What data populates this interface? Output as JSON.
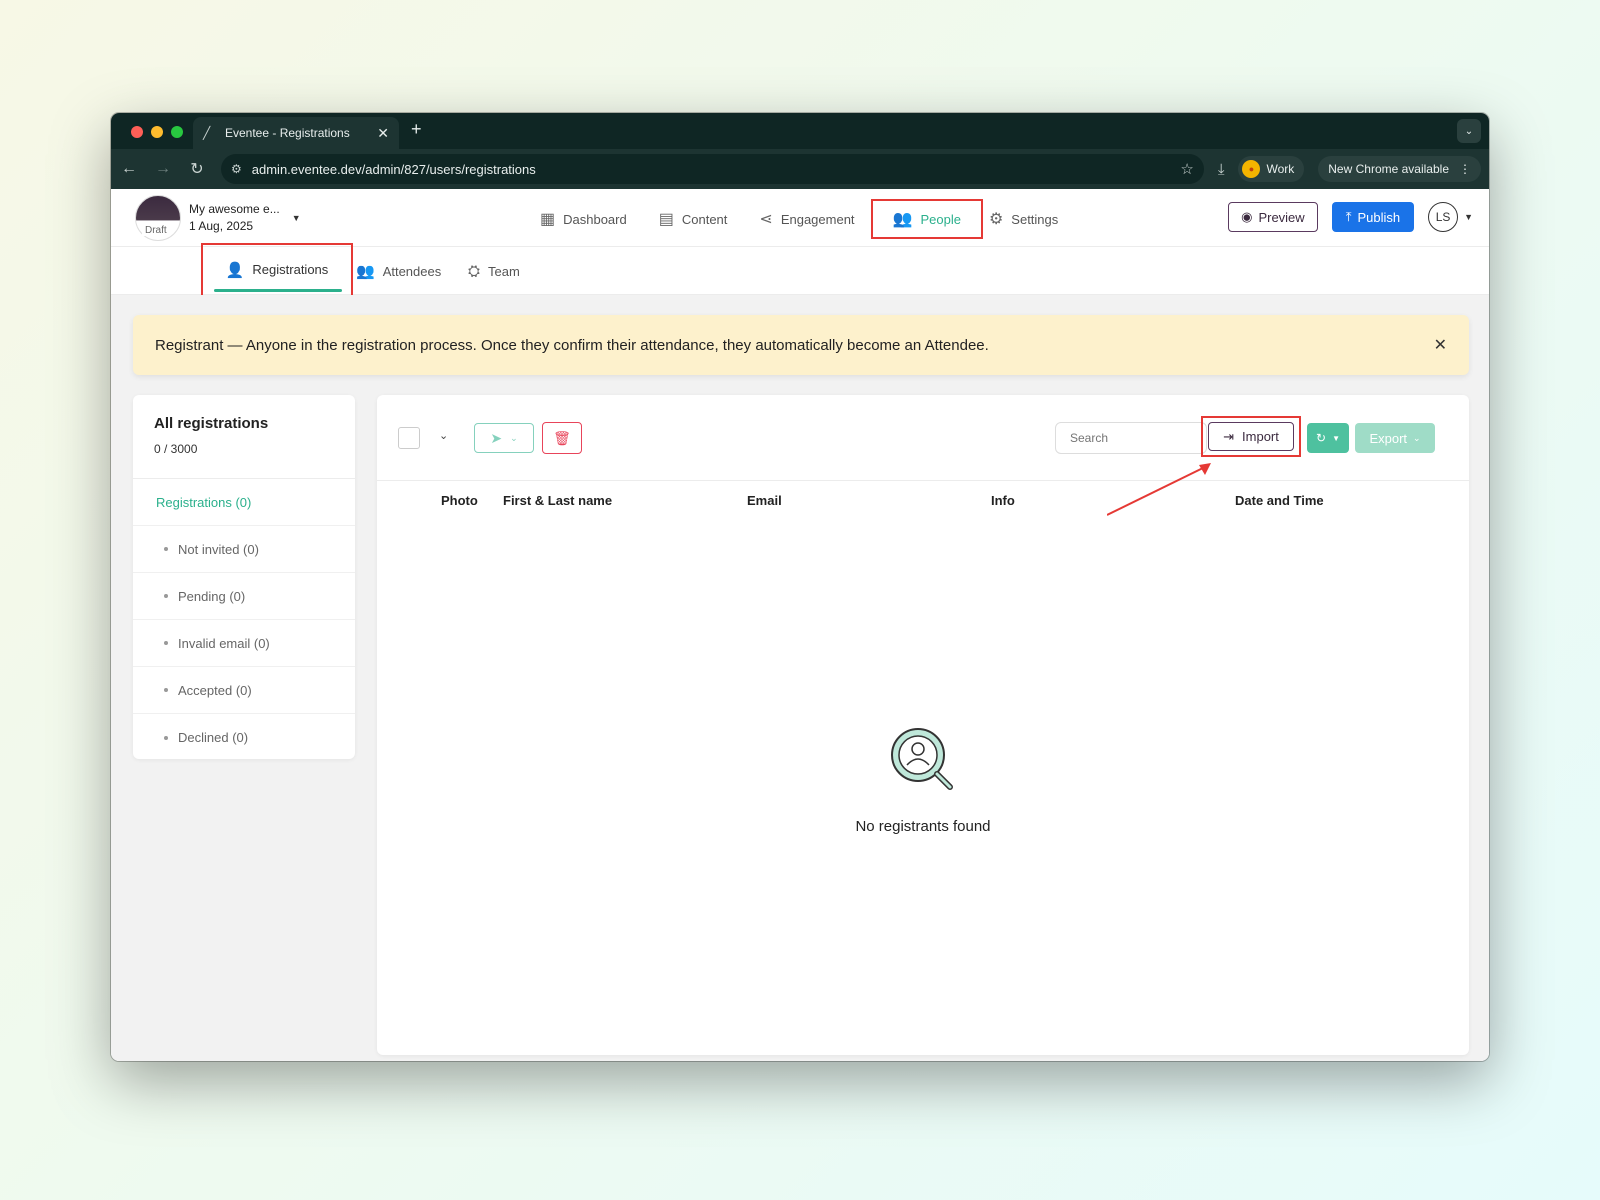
{
  "browser": {
    "tab_title": "Eventee - Registrations",
    "url": "admin.eventee.dev/admin/827/users/registrations",
    "profile_label": "Work",
    "update_label": "New Chrome available"
  },
  "header": {
    "event_name": "My awesome e...",
    "event_date": "1 Aug, 2025",
    "event_status": "Draft",
    "nav": [
      {
        "label": "Dashboard",
        "icon": "dashboard-icon"
      },
      {
        "label": "Content",
        "icon": "calendar-icon"
      },
      {
        "label": "Engagement",
        "icon": "share-icon"
      },
      {
        "label": "People",
        "icon": "people-icon",
        "active": true
      },
      {
        "label": "Settings",
        "icon": "gear-icon"
      }
    ],
    "preview_label": "Preview",
    "publish_label": "Publish",
    "user_initials": "LS"
  },
  "subtabs": [
    {
      "label": "Registrations",
      "active": true
    },
    {
      "label": "Attendees"
    },
    {
      "label": "Team"
    }
  ],
  "banner": {
    "text": "Registrant — Anyone in the registration process. Once they confirm their attendance, they automatically become an Attendee."
  },
  "sidebar": {
    "title": "All registrations",
    "count": "0 / 3000",
    "items": [
      {
        "label": "Registrations (0)",
        "primary": true
      },
      {
        "label": "Not invited (0)"
      },
      {
        "label": "Pending (0)"
      },
      {
        "label": "Invalid email (0)"
      },
      {
        "label": "Accepted (0)"
      },
      {
        "label": "Declined (0)"
      }
    ]
  },
  "toolbar": {
    "search_placeholder": "Search",
    "import_label": "Import",
    "export_label": "Export"
  },
  "table": {
    "columns": [
      "Photo",
      "First & Last name",
      "Email",
      "Info",
      "Date and Time"
    ]
  },
  "empty_state": {
    "message": "No registrants found"
  },
  "colors": {
    "accent": "#2bb08c",
    "publish": "#1a73e8",
    "highlight": "#e53935",
    "banner": "#fdf1cc",
    "delete": "#e8445a"
  }
}
